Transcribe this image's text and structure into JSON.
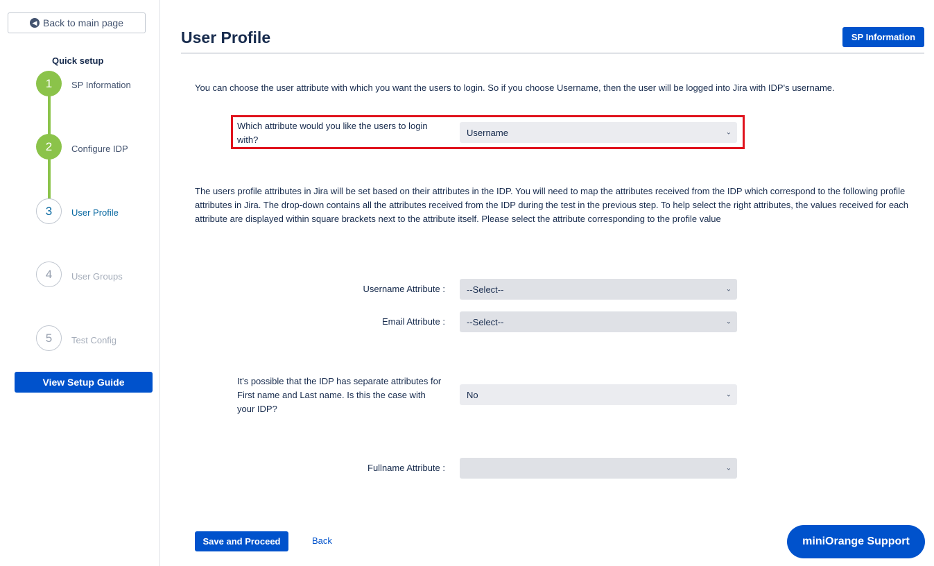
{
  "sidebar": {
    "back_label": "Back to main page",
    "back_icon": "arrow-left-circle-icon",
    "quick_setup_title": "Quick setup",
    "steps": [
      {
        "number": "1",
        "label": "SP Information",
        "state": "done"
      },
      {
        "number": "2",
        "label": "Configure IDP",
        "state": "done"
      },
      {
        "number": "3",
        "label": "User Profile",
        "state": "current"
      },
      {
        "number": "4",
        "label": "User Groups",
        "state": "todo"
      },
      {
        "number": "5",
        "label": "Test Config",
        "state": "todo"
      }
    ],
    "guide_label": "View Setup Guide"
  },
  "header": {
    "title": "User Profile",
    "sp_button_label": "SP Information"
  },
  "main": {
    "intro": "You can choose the user attribute with which you want the users to login. So if you choose Username, then the user will be logged into Jira with IDP's username.",
    "login_attr": {
      "label": "Which attribute would you like the users to login with?",
      "value": "Username"
    },
    "mapping_text": "The users profile attributes in Jira will be set based on their attributes in the IDP. You will need to map the attributes received from the IDP which correspond to the following profile attributes in Jira. The drop-down contains all the attributes received from the IDP during the test in the previous step. To help select the right attributes, the values received for each attribute are displayed within square brackets next to the attribute itself. Please select the attribute corresponding to the profile value",
    "username_attr": {
      "label": "Username Attribute :",
      "value": "--Select--"
    },
    "email_attr": {
      "label": "Email Attribute :",
      "value": "--Select--"
    },
    "separate_names": {
      "label": "It's possible that the IDP has separate attributes for First name and Last name. Is this the case with your IDP?",
      "value": "No"
    },
    "fullname_attr": {
      "label": "Fullname Attribute :",
      "value": ""
    }
  },
  "footer": {
    "save_label": "Save and Proceed",
    "back_label": "Back",
    "support_label": "miniOrange Support"
  },
  "colors": {
    "primary": "#0052cc",
    "step_done": "#8bc34a",
    "highlight": "#e0131d"
  }
}
